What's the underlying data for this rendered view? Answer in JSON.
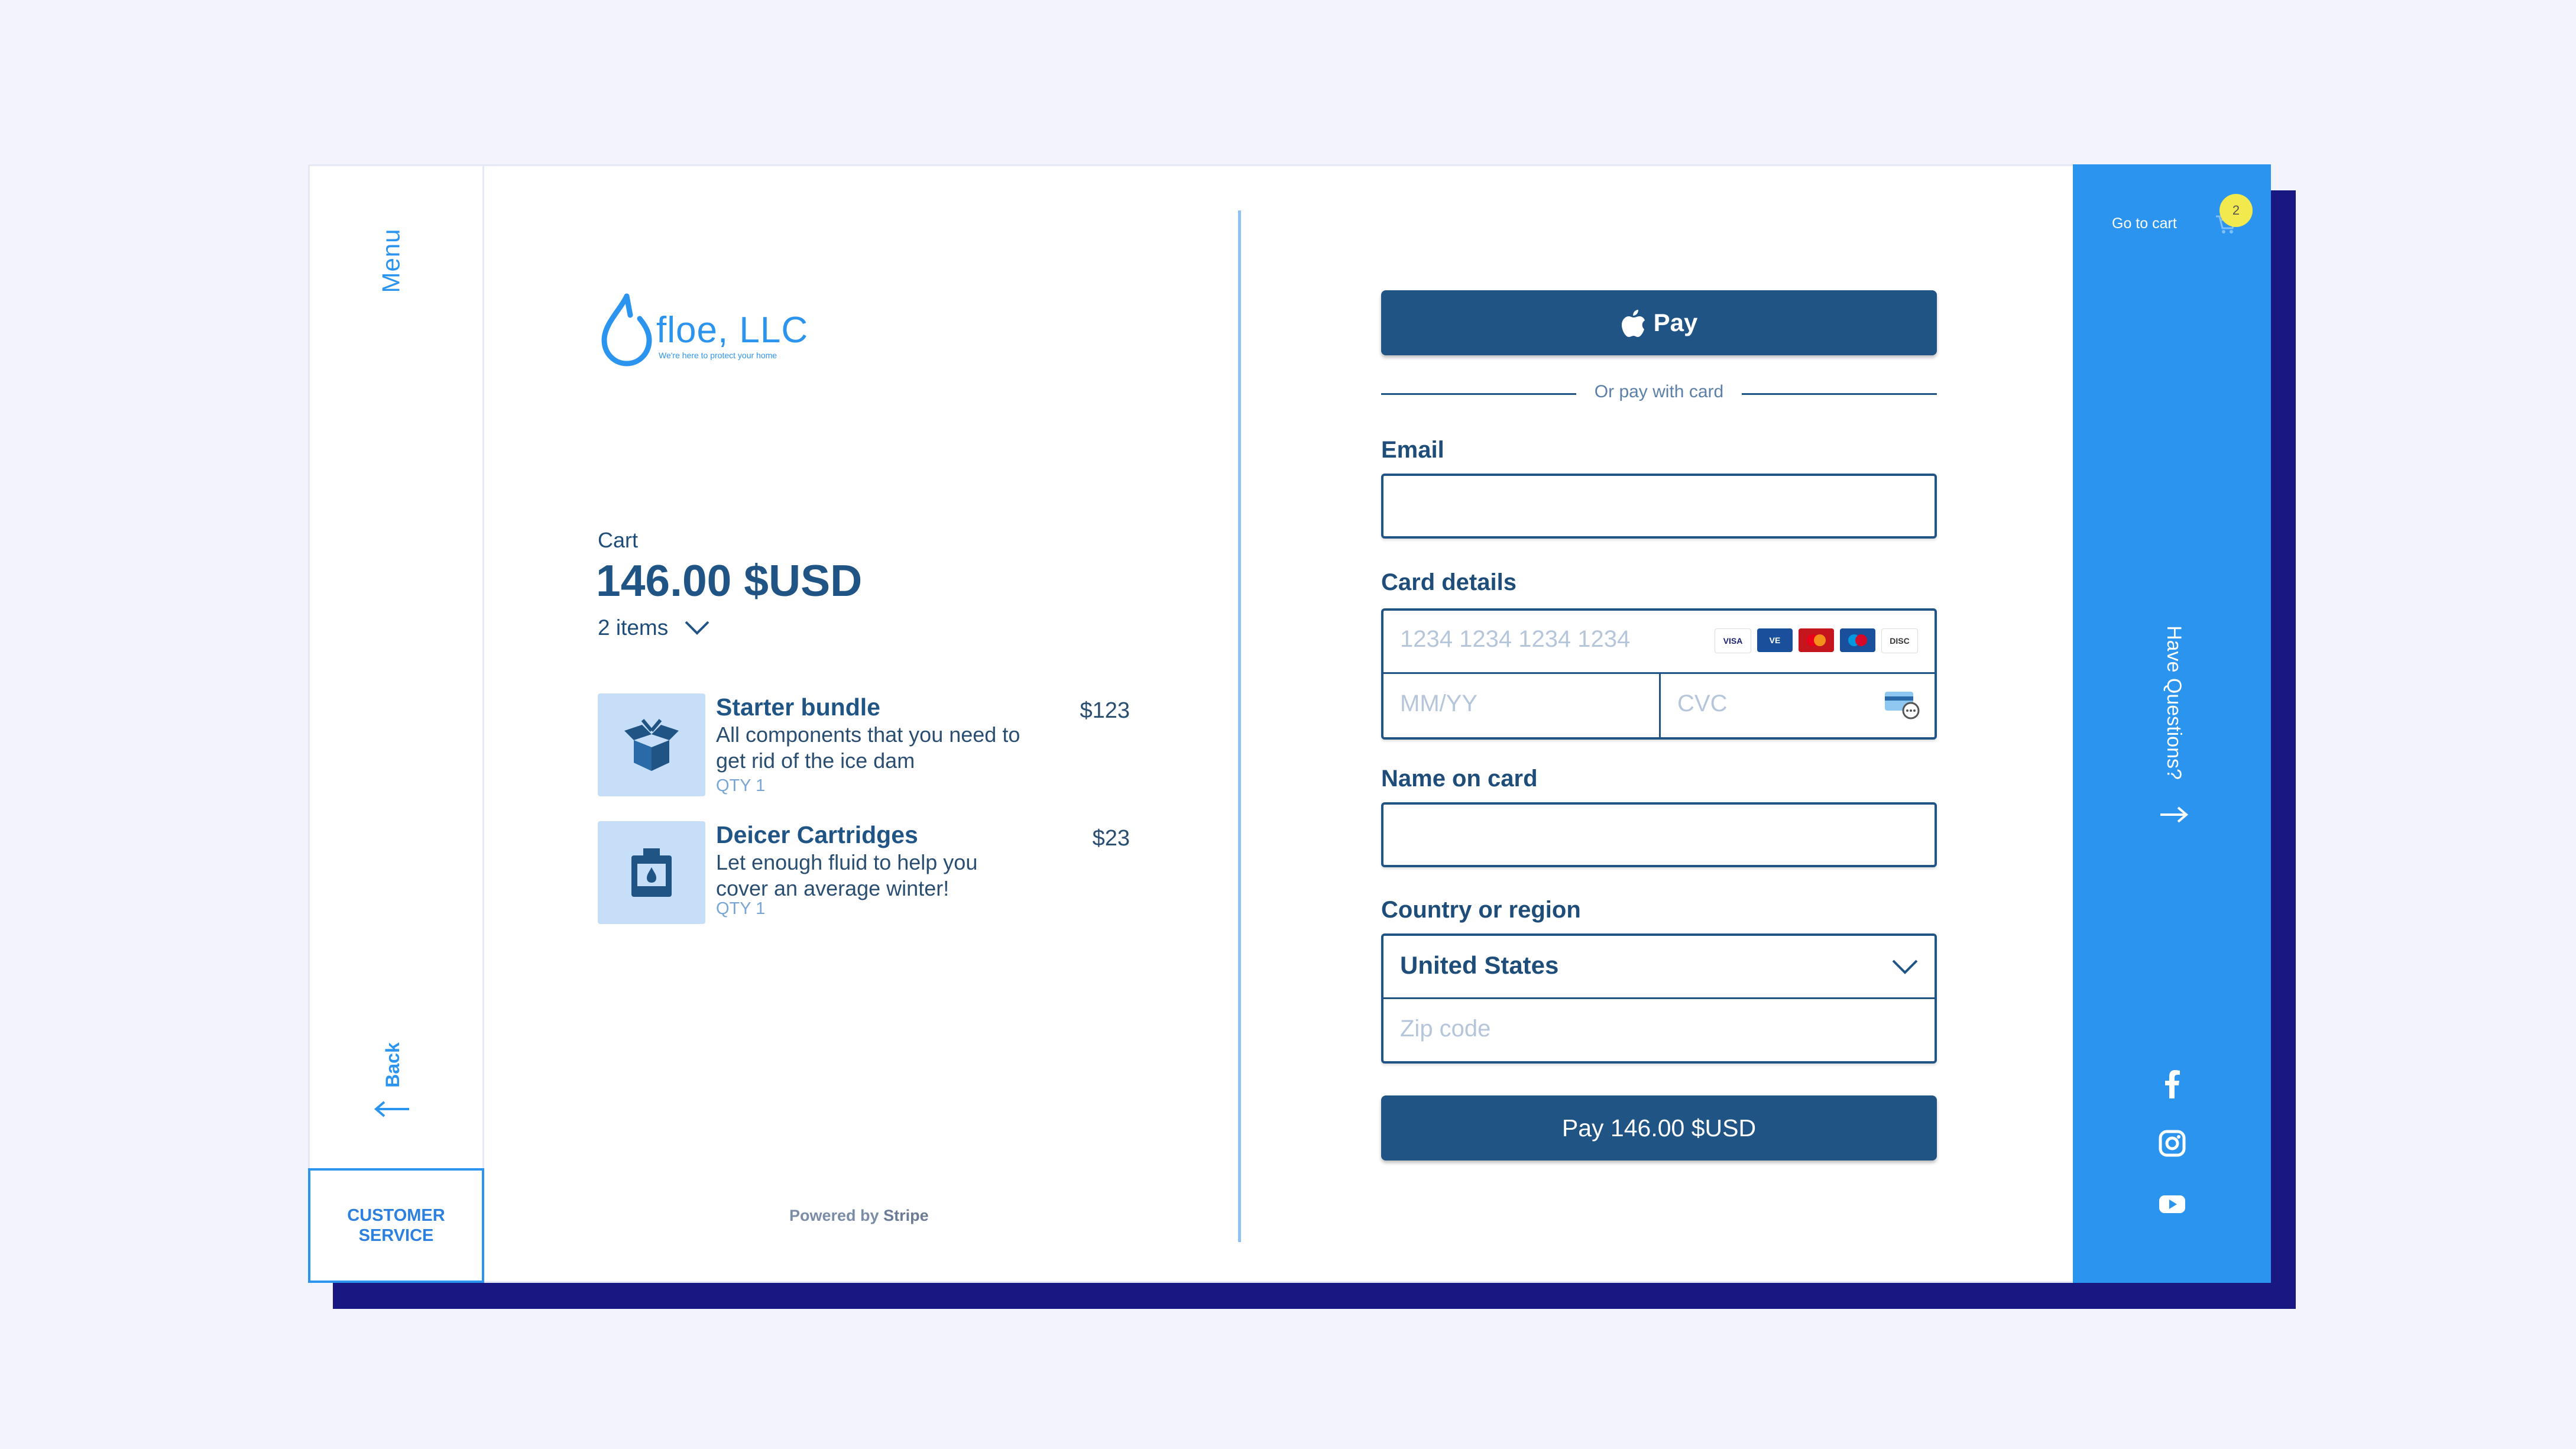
{
  "rail": {
    "menu_label": "Menu",
    "back_label": "Back",
    "customer_service_label": "CUSTOMER SERVICE"
  },
  "brand": {
    "name": "floe, LLC",
    "tagline": "We're here to protect your home"
  },
  "cart": {
    "label": "Cart",
    "total": "146.00 $USD",
    "item_count": "2 items",
    "items": [
      {
        "title": "Starter bundle",
        "description": "All components that you need to get rid of the ice dam",
        "qty": "QTY 1",
        "price": "$123",
        "icon": "open-box-icon"
      },
      {
        "title": "Deicer Cartridges",
        "description": "Let enough fluid to help you cover an average winter!",
        "qty": "QTY 1",
        "price": "$23",
        "icon": "cartridge-icon"
      }
    ]
  },
  "powered_by": {
    "prefix": "Powered by",
    "brand": "Stripe"
  },
  "checkout": {
    "apple_pay_label": "Pay",
    "or_text": "Or pay with card",
    "email_label": "Email",
    "email_value": "",
    "card_label": "Card details",
    "card_number_placeholder": "1234 1234 1234 1234",
    "expiry_placeholder": "MM/YY",
    "cvc_placeholder": "CVC",
    "card_brands": [
      "VISA",
      "VISA Electron",
      "MasterCard",
      "Maestro",
      "DISCOVER"
    ],
    "name_label": "Name on card",
    "name_value": "",
    "country_label": "Country or region",
    "country_value": "United States",
    "zip_placeholder": "Zip code",
    "pay_button": "Pay 146.00 $USD"
  },
  "side_panel": {
    "go_to_cart": "Go to cart",
    "cart_badge": "2",
    "have_questions": "Have Questions?",
    "social": [
      "facebook-icon",
      "instagram-icon",
      "youtube-icon"
    ]
  },
  "colors": {
    "primary": "#1f5485",
    "accent": "#2b94ef",
    "background": "#f2f3fb",
    "shadow": "#191883",
    "badge": "#f2e94e"
  }
}
